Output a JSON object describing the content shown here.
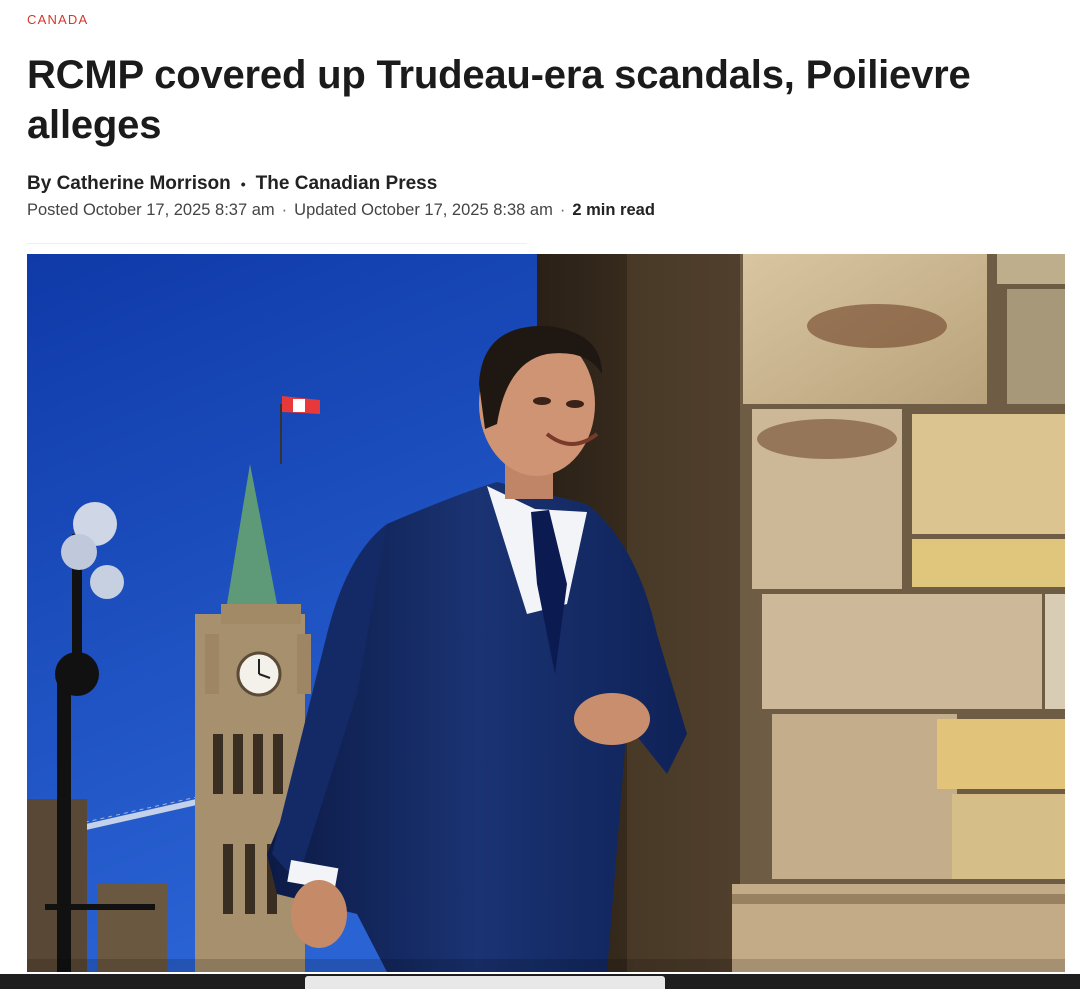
{
  "article": {
    "category": "CANADA",
    "headline": "RCMP covered up Trudeau-era scandals, Poilievre alleges",
    "byline": {
      "author": "By Catherine Morrison",
      "separator": "•",
      "outlet": "The Canadian Press"
    },
    "meta": {
      "posted": "Posted October 17, 2025 8:37 am",
      "dot1": "·",
      "updated": "Updated October 17, 2025 8:38 am",
      "dot2": "·",
      "read_time": "2 min read"
    }
  },
  "colors": {
    "category": "#d0392b",
    "sky": "#1846b5",
    "suit": "#14285e",
    "stone": "#c9b590",
    "copper_roof": "#5f9a78"
  }
}
